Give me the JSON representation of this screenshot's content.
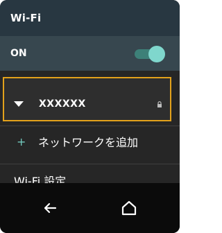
{
  "header": {
    "title": "Wi-Fi"
  },
  "wifi_toggle": {
    "label": "ON",
    "state": "on",
    "accent": "#7fd7cd"
  },
  "networks": [
    {
      "name": "XXXXXX",
      "icon": "wifi-signal-icon",
      "secured_icon": "lock-icon",
      "highlight_color": "#e3a21b"
    }
  ],
  "add_network": {
    "icon": "plus-icon",
    "label": "ネットワークを追加"
  },
  "settings": {
    "label": "Wi-Fi 設定"
  },
  "navbar": {
    "back_icon": "back-arrow-icon",
    "home_icon": "home-icon"
  }
}
